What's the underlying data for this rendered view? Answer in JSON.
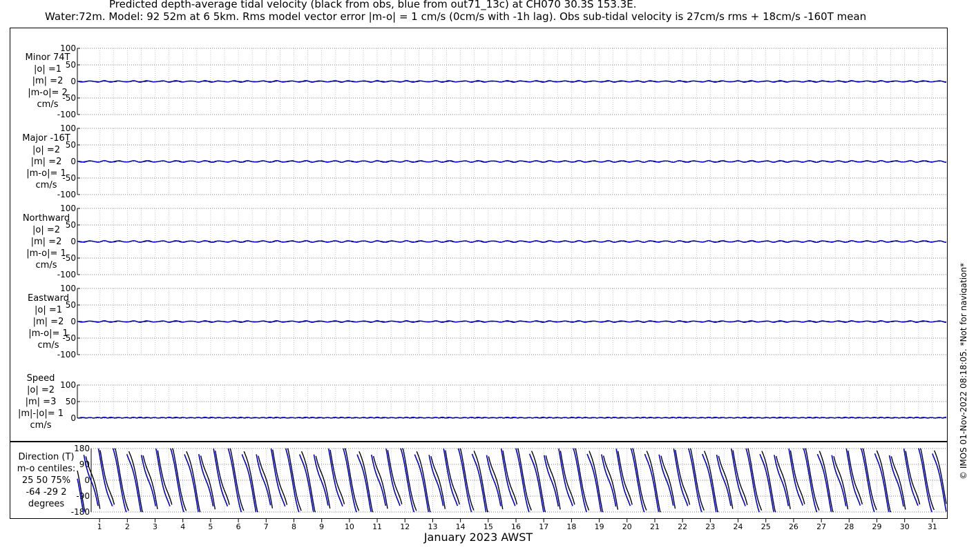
{
  "header": {
    "title": "Predicted depth-average tidal velocity (black from obs, blue from out71_13c) at CH070 30.3S 153.3E.",
    "subtitle": "Water:72m. Model: 92 52m at 6 5km. Rms model vector error |m-o| = 1 cm/s (0cm/s with -1h lag). Obs sub-tidal velocity is 27cm/s rms + 18cm/s -160T mean"
  },
  "watermark": "© IMOS 01-Nov-2022 08:18:05. *Not for navigation*",
  "chart_data": {
    "type": "line",
    "xlabel": "January 2023 AWST",
    "x_ticks": [
      "1",
      "2",
      "3",
      "4",
      "5",
      "6",
      "7",
      "8",
      "9",
      "10",
      "11",
      "12",
      "13",
      "14",
      "15",
      "16",
      "17",
      "18",
      "19",
      "20",
      "21",
      "22",
      "23",
      "24",
      "25",
      "26",
      "27",
      "28",
      "29",
      "30",
      "31"
    ],
    "xlim": [
      0.2,
      31.5
    ],
    "grid": true,
    "series_colors": {
      "obs": "#000000",
      "model": "#0000cc"
    },
    "panels": [
      {
        "id": "minor",
        "label_lines": [
          "Minor 74T",
          "|o| =1",
          "|m| =2",
          "|m-o|= 2",
          "cm/s"
        ],
        "ylim": [
          -100,
          100
        ],
        "yticks": [
          100,
          50,
          0,
          -50,
          -100
        ],
        "obs_amp": 1,
        "model_amp": 2,
        "speed": false
      },
      {
        "id": "major",
        "label_lines": [
          "Major -16T",
          "|o| =2",
          "|m| =2",
          "|m-o|= 1",
          "cm/s"
        ],
        "ylim": [
          -100,
          100
        ],
        "yticks": [
          100,
          50,
          0,
          -50,
          -100
        ],
        "obs_amp": 2,
        "model_amp": 2,
        "speed": false
      },
      {
        "id": "north",
        "label_lines": [
          "Northward",
          "|o| =2",
          "|m| =2",
          "|m-o|= 1",
          "cm/s"
        ],
        "ylim": [
          -100,
          100
        ],
        "yticks": [
          100,
          50,
          0,
          -50,
          -100
        ],
        "obs_amp": 2,
        "model_amp": 2,
        "speed": false
      },
      {
        "id": "east",
        "label_lines": [
          "Eastward",
          "|o| =1",
          "|m| =2",
          "|m-o|= 1",
          "cm/s"
        ],
        "ylim": [
          -100,
          100
        ],
        "yticks": [
          100,
          50,
          0,
          -50,
          -100
        ],
        "obs_amp": 1,
        "model_amp": 2,
        "speed": false
      },
      {
        "id": "speed",
        "label_lines": [
          "Speed",
          "|o| =2",
          "|m| =3",
          "|m|-|o|= 1",
          "cm/s"
        ],
        "ylim": [
          0,
          100
        ],
        "yticks": [
          100,
          50,
          0
        ],
        "obs_amp": 2,
        "model_amp": 3,
        "speed": true
      }
    ],
    "direction": {
      "label_lines": [
        "Direction (T)",
        "m-o centiles:",
        "25  50  75%",
        "-64 -29   2",
        "degrees"
      ],
      "ylim": [
        -180,
        180
      ],
      "yticks": [
        180,
        90,
        0,
        -90,
        -180
      ],
      "centiles": [
        -64,
        -29,
        2
      ]
    }
  }
}
